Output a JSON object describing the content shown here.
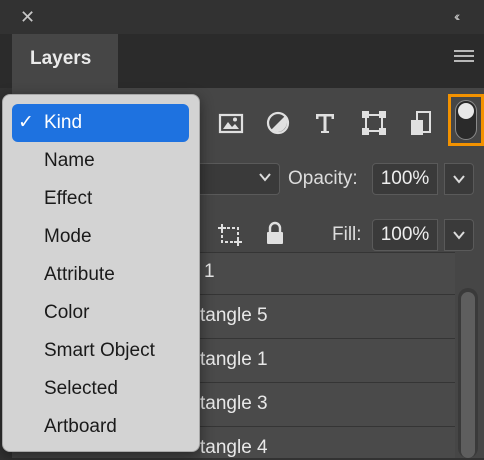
{
  "window": {
    "close_glyph": "✕",
    "collapse_glyph": "‹‹"
  },
  "panel": {
    "tab_label": "Layers"
  },
  "filter_menu": {
    "selected": "Kind",
    "items": [
      "Kind",
      "Name",
      "Effect",
      "Mode",
      "Attribute",
      "Color",
      "Smart Object",
      "Selected",
      "Artboard"
    ]
  },
  "opacity": {
    "label": "Opacity:",
    "value": "100%"
  },
  "fill": {
    "label": "Fill:",
    "value": "100%"
  },
  "layers": [
    {
      "name_visible": "1"
    },
    {
      "name_visible": "tangle 5"
    },
    {
      "name_visible": "tangle 1"
    },
    {
      "name_visible": "tangle 3"
    },
    {
      "name_visible": "tangle 4"
    }
  ],
  "icons": [
    "close-icon",
    "collapse-panel-icon",
    "panel-menu-icon",
    "image-filter-icon",
    "adjustment-filter-icon",
    "type-filter-icon",
    "shape-filter-icon",
    "smart-object-filter-icon",
    "filter-toggle",
    "artboard-lock-icon",
    "lock-all-icon",
    "chevron-down-icon",
    "checkmark-icon"
  ],
  "colors": {
    "panel": "#464646",
    "background": "#323232",
    "menu": "#d3d3d3",
    "selection": "#1e72e0",
    "highlight": "#f39200"
  }
}
